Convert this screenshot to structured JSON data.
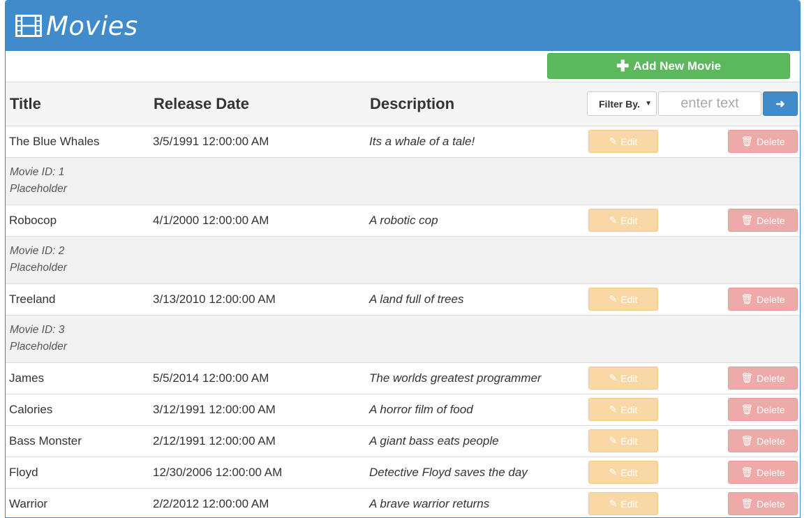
{
  "header": {
    "title": "Movies",
    "icon": "film-icon",
    "bg_color": "#428bca"
  },
  "toolbar": {
    "add_label": "Add New Movie",
    "add_icon": "plus-icon"
  },
  "table": {
    "columns": [
      "Title",
      "Release Date",
      "Description"
    ],
    "filter": {
      "selected": "Filter By.",
      "placeholder": "enter text",
      "go_icon": "arrow-right-icon"
    },
    "edit_label": "Edit",
    "delete_label": "Delete",
    "rows": [
      {
        "title": "The Blue Whales",
        "date": "3/5/1991 12:00:00 AM",
        "description": "Its a whale of a tale!",
        "detail_id": "Movie ID: 1",
        "detail_text": "Placeholder"
      },
      {
        "title": "Robocop",
        "date": "4/1/2000 12:00:00 AM",
        "description": "A robotic cop",
        "detail_id": "Movie ID: 2",
        "detail_text": "Placeholder"
      },
      {
        "title": "Treeland",
        "date": "3/13/2010 12:00:00 AM",
        "description": "A land full of trees",
        "detail_id": "Movie ID: 3",
        "detail_text": "Placeholder"
      },
      {
        "title": "James",
        "date": "5/5/2014 12:00:00 AM",
        "description": "The worlds greatest programmer"
      },
      {
        "title": "Calories",
        "date": "3/12/1991 12:00:00 AM",
        "description": "A horror film of food"
      },
      {
        "title": "Bass Monster",
        "date": "2/12/1991 12:00:00 AM",
        "description": "A giant bass eats people"
      },
      {
        "title": "Floyd",
        "date": "12/30/2006 12:00:00 AM",
        "description": "Detective Floyd saves the day"
      },
      {
        "title": "Warrior",
        "date": "2/2/2012 12:00:00 AM",
        "description": "A brave warrior returns"
      }
    ]
  },
  "colors": {
    "success": "#5cb85c",
    "warning_light": "#f9d8a5",
    "danger_light": "#eeaaa8",
    "primary": "#428bca"
  }
}
